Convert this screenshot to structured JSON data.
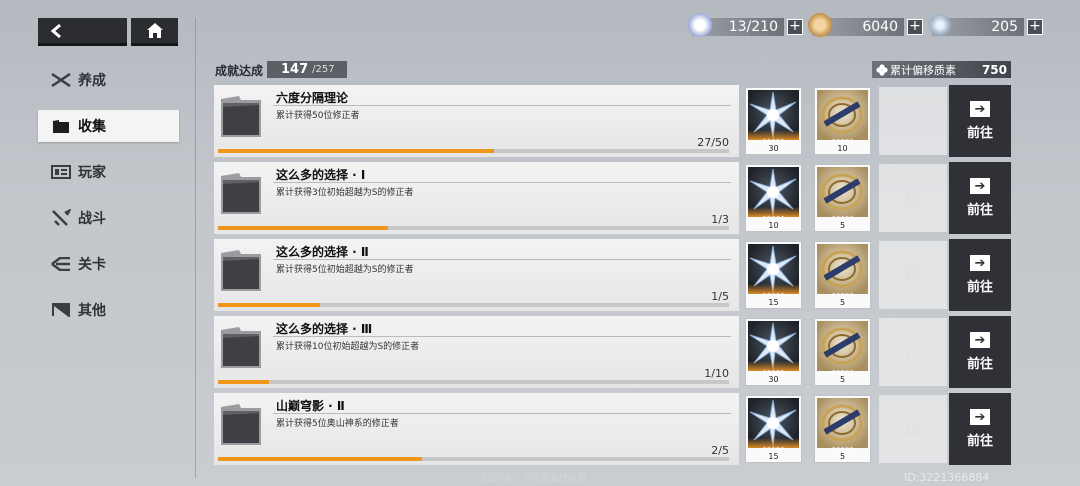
{
  "nav": {
    "back_icon": "chevron-left-icon",
    "home_icon": "home-icon"
  },
  "sidebar": {
    "items": [
      {
        "label": "养成",
        "icon": "crossed-swords-icon",
        "active": false
      },
      {
        "label": "收集",
        "icon": "folder-icon",
        "active": true
      },
      {
        "label": "玩家",
        "icon": "id-card-icon",
        "active": false
      },
      {
        "label": "战斗",
        "icon": "sword-icon",
        "active": false
      },
      {
        "label": "关卡",
        "icon": "stage-icon",
        "active": false
      },
      {
        "label": "其他",
        "icon": "flag-icon",
        "active": false
      }
    ]
  },
  "resources": {
    "stamina": {
      "value": "13/210",
      "icon": "stamina-icon"
    },
    "coins": {
      "value": "6040",
      "icon": "coin-icon"
    },
    "crystals": {
      "value": "205",
      "icon": "crystal-star-icon"
    },
    "plus_label": "+"
  },
  "header": {
    "achieved_label": "成就达成",
    "achieved_count": "147",
    "achieved_total": "/257",
    "drift_label": "累计偏移质素",
    "drift_value": "750"
  },
  "achievements": [
    {
      "title": "六度分隔理论",
      "desc": "累计获得50位修正者",
      "progress_text": "27/50",
      "progress": 0.54,
      "reward_crystal": "30",
      "reward_coin": "10"
    },
    {
      "title": "这么多的选择 · Ⅰ",
      "desc": "累计获得3位初始超越为S的修正者",
      "progress_text": "1/3",
      "progress": 0.333,
      "reward_crystal": "10",
      "reward_coin": "5"
    },
    {
      "title": "这么多的选择 · Ⅱ",
      "desc": "累计获得5位初始超越为S的修正者",
      "progress_text": "1/5",
      "progress": 0.2,
      "reward_crystal": "15",
      "reward_coin": "5"
    },
    {
      "title": "这么多的选择 · Ⅲ",
      "desc": "累计获得10位初始超越为S的修正者",
      "progress_text": "1/10",
      "progress": 0.1,
      "reward_crystal": "30",
      "reward_coin": "5"
    },
    {
      "title": "山巅穹影 · Ⅱ",
      "desc": "累计获得5位奥山神系的修正者",
      "progress_text": "2/5",
      "progress": 0.4,
      "reward_crystal": "15",
      "reward_coin": "5"
    }
  ],
  "stars": "★★★★★",
  "go_label": "前往",
  "footer_note": "测试阶段，不代表最终品质",
  "uid": "ID:3221366884"
}
